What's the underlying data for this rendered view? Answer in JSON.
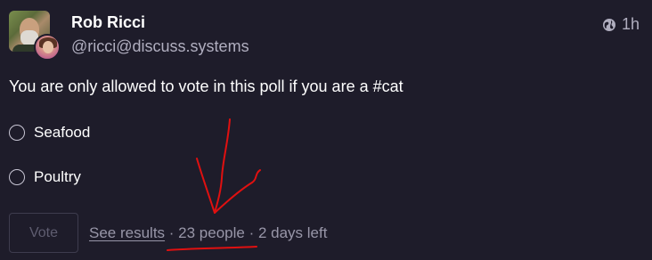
{
  "author": {
    "display_name": "Rob Ricci",
    "handle": "@ricci@discuss.systems"
  },
  "meta": {
    "visibility_icon": "globe-icon",
    "relative_time": "1h"
  },
  "status": {
    "text_before_tag": "You are only allowed to vote in this poll if you are a ",
    "hashtag": "#cat"
  },
  "poll": {
    "options": [
      {
        "label": "Seafood",
        "selected": false
      },
      {
        "label": "Poultry",
        "selected": false
      }
    ],
    "vote_label": "Vote",
    "see_results_label": "See results",
    "separator": " · ",
    "voters": "23 people",
    "time_left": "2 days left"
  },
  "colors": {
    "background": "#1e1c2a",
    "annotation": "#e01010"
  }
}
